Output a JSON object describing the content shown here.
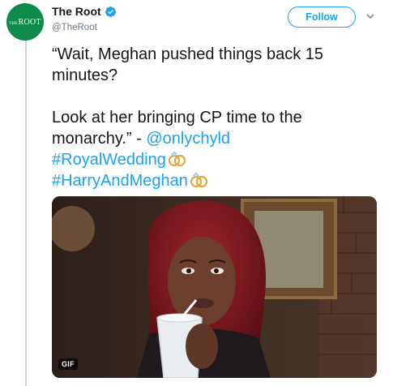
{
  "author": {
    "display_name": "The Root",
    "handle": "@TheRoot",
    "verified": true,
    "avatar_logo_small": "THE",
    "avatar_logo_main": "ROOT"
  },
  "follow_button": {
    "label": "Follow"
  },
  "tweet": {
    "line1": "“Wait, Meghan pushed things back 15 minutes?",
    "line2_prefix": "Look at her bringing CP time to the monarchy.” - ",
    "mention": "@onlychyld",
    "hashtag1": "#RoyalWedding",
    "hashtag2": "#HarryAndMeghan"
  },
  "media": {
    "badge": "GIF"
  },
  "icons": {
    "verified": "verified-badge-icon",
    "caret": "chevron-down-icon",
    "hashtag_emoji": "wedding-rings-icon"
  },
  "colors": {
    "accent": "#1da1f2",
    "brand_green": "#0e8b4a",
    "text": "#14171a",
    "muted": "#657786"
  }
}
